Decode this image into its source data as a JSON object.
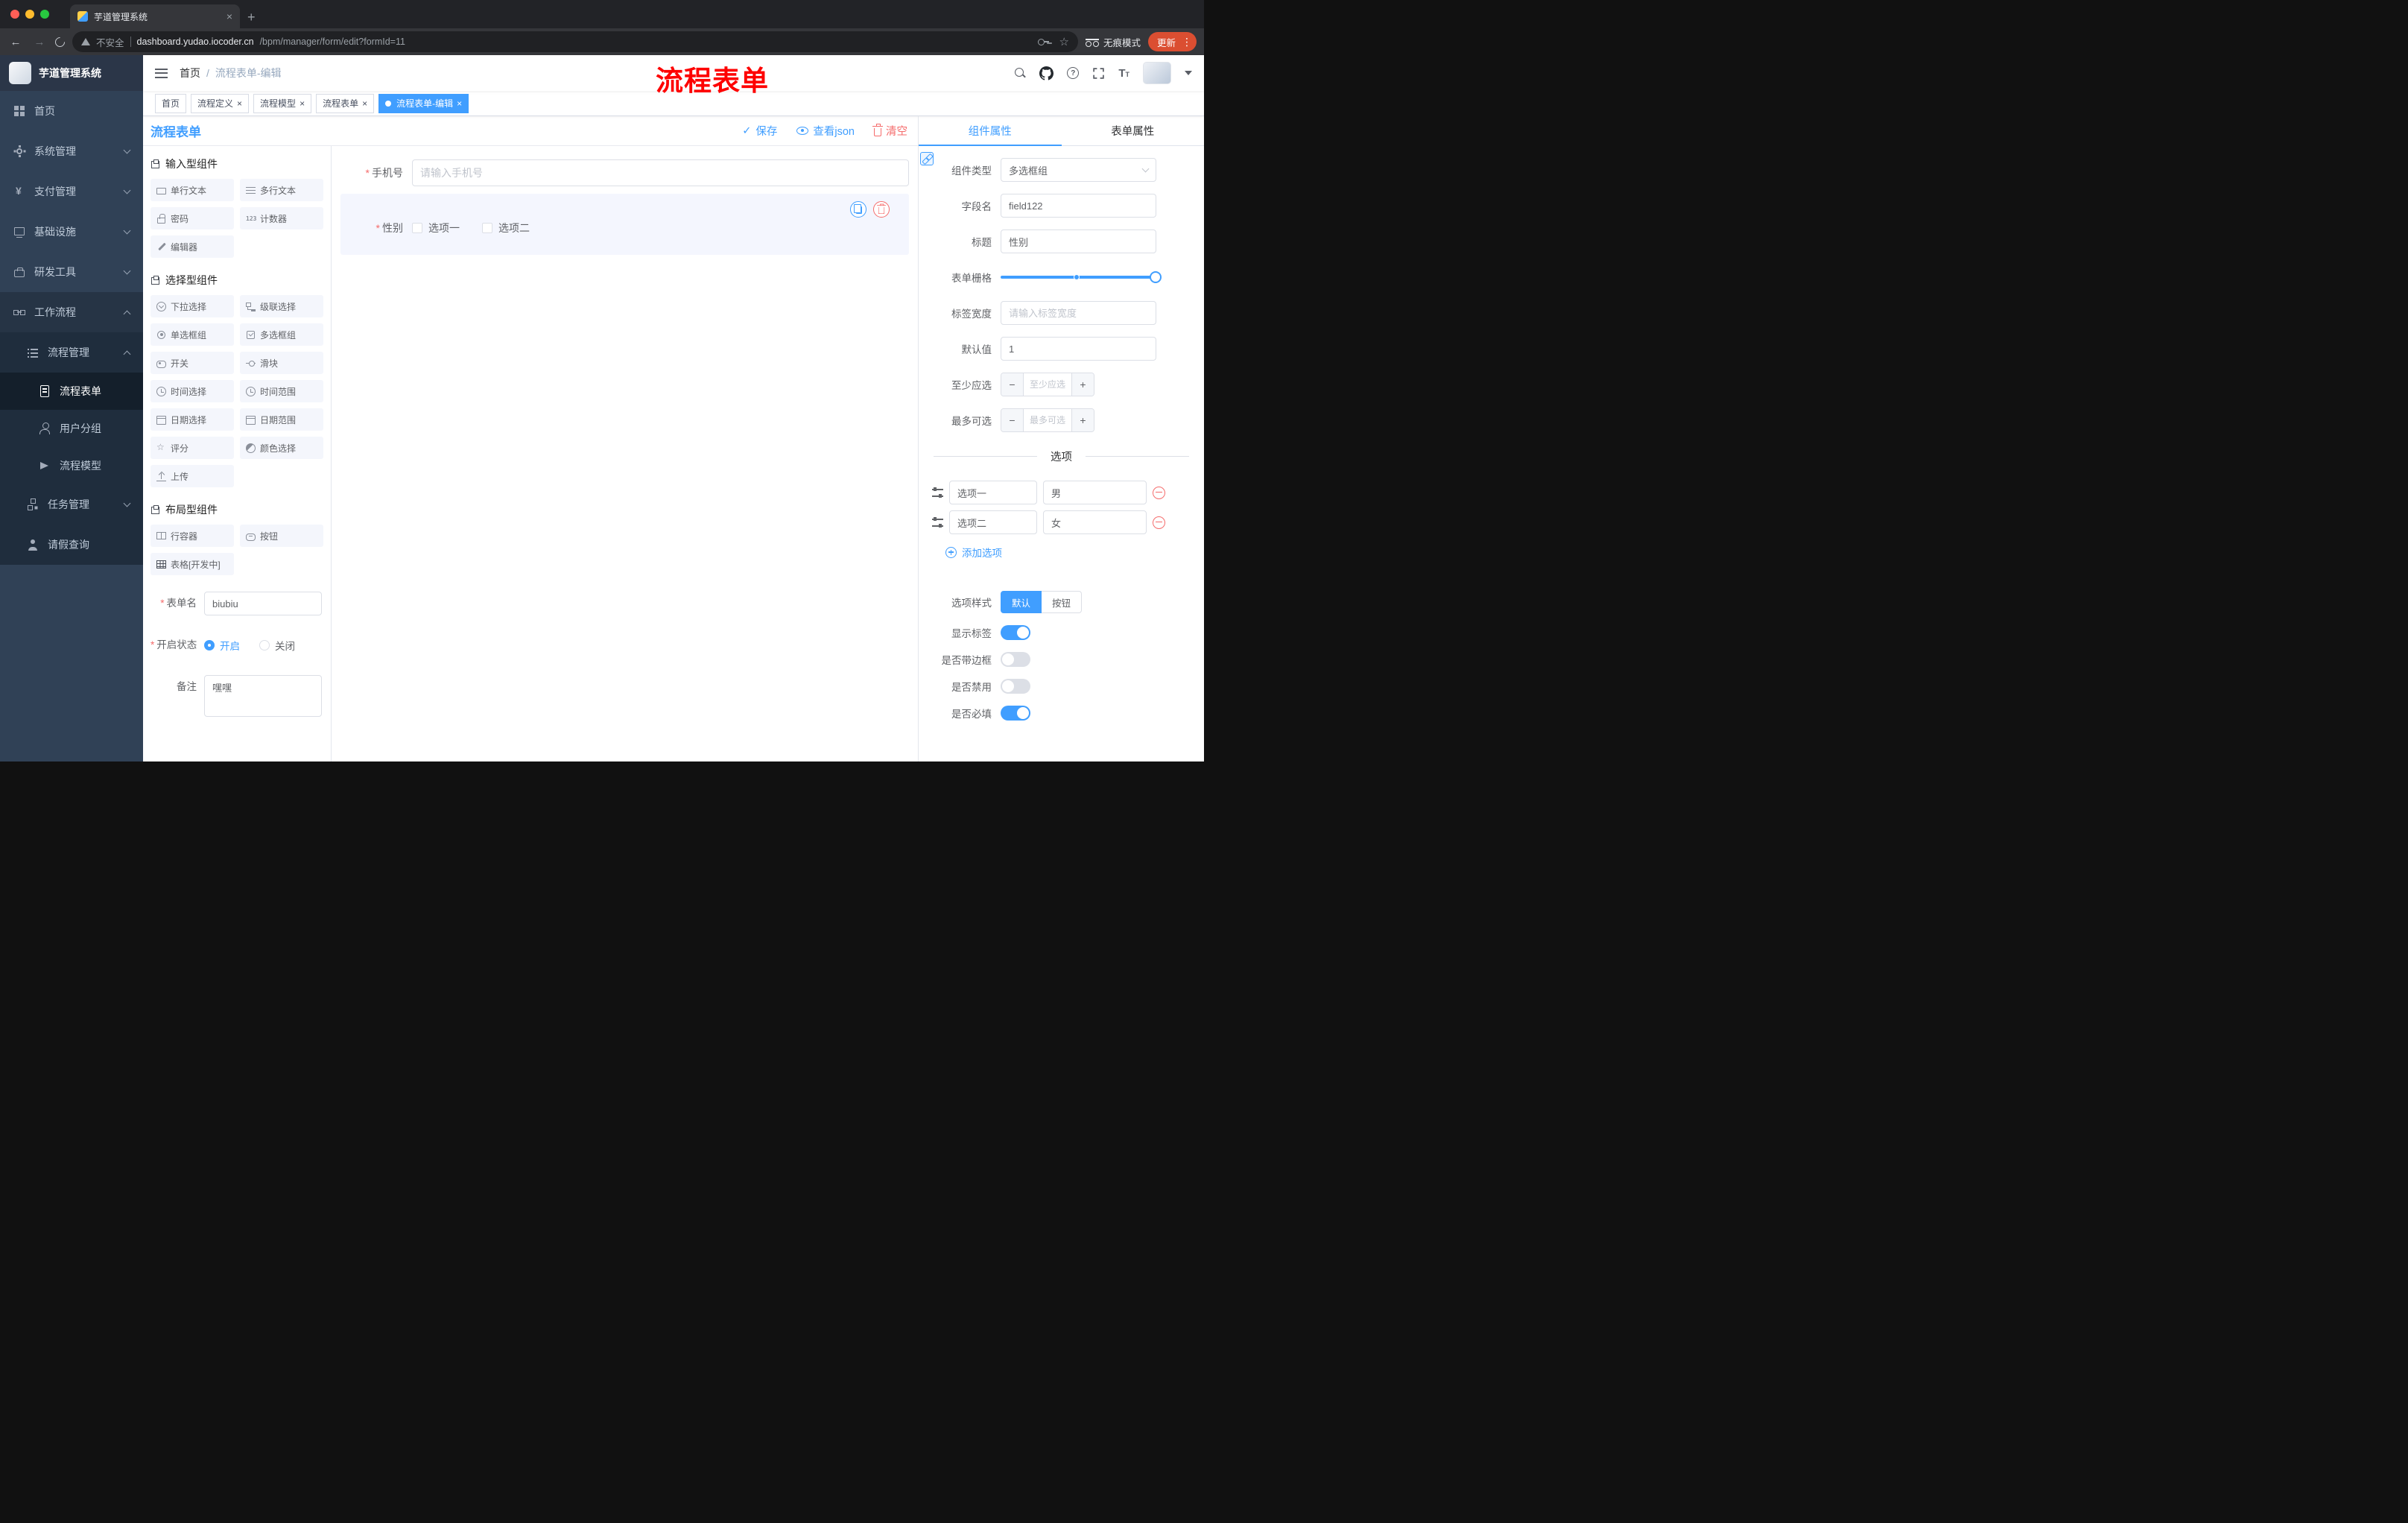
{
  "browser": {
    "tab_title": "芋道管理系统",
    "security_label": "不安全",
    "url_host": "dashboard.yudao.iocoder.cn",
    "url_path": "/bpm/manager/form/edit?formId=11",
    "incognito_label": "无痕模式",
    "update_label": "更新"
  },
  "sidebar": {
    "logo_title": "芋道管理系统",
    "menu": {
      "home": "首页",
      "system": "系统管理",
      "payment": "支付管理",
      "infra": "基础设施",
      "devtools": "研发工具",
      "workflow": "工作流程",
      "process_mgmt": "流程管理",
      "process_form": "流程表单",
      "user_group": "用户分组",
      "process_model": "流程模型",
      "task_mgmt": "任务管理",
      "leave_query": "请假查询"
    }
  },
  "header": {
    "breadcrumb_home": "首页",
    "breadcrumb_current": "流程表单-编辑",
    "annotation": "流程表单"
  },
  "tagsview": [
    "首页",
    "流程定义",
    "流程模型",
    "流程表单",
    "流程表单-编辑"
  ],
  "designer": {
    "title": "流程表单",
    "save": "保存",
    "view_json": "查看json",
    "clear": "清空"
  },
  "palette": {
    "groups": [
      {
        "title": "输入型组件",
        "items": [
          {
            "label": "单行文本",
            "icon": "text-field"
          },
          {
            "label": "多行文本",
            "icon": "textarea"
          },
          {
            "label": "密码",
            "icon": "lock"
          },
          {
            "label": "计数器",
            "icon": "counter-123"
          },
          {
            "label": "编辑器",
            "icon": "editor-pencil"
          }
        ]
      },
      {
        "title": "选择型组件",
        "items": [
          {
            "label": "下拉选择",
            "icon": "select-dropdown"
          },
          {
            "label": "级联选择",
            "icon": "cascader-tree"
          },
          {
            "label": "单选框组",
            "icon": "radio-group"
          },
          {
            "label": "多选框组",
            "icon": "checkbox-group"
          },
          {
            "label": "开关",
            "icon": "switch"
          },
          {
            "label": "滑块",
            "icon": "slider"
          },
          {
            "label": "时间选择",
            "icon": "time-clock"
          },
          {
            "label": "时间范围",
            "icon": "time-range-clock"
          },
          {
            "label": "日期选择",
            "icon": "date-calendar"
          },
          {
            "label": "日期范围",
            "icon": "date-range-calendar"
          },
          {
            "label": "评分",
            "icon": "rate-star"
          },
          {
            "label": "颜色选择",
            "icon": "color-picker"
          },
          {
            "label": "上传",
            "icon": "upload"
          }
        ]
      },
      {
        "title": "布局型组件",
        "items": [
          {
            "label": "行容器",
            "icon": "row-container"
          },
          {
            "label": "按钮",
            "icon": "button"
          },
          {
            "label": "表格[开发中]",
            "icon": "table-grid"
          }
        ]
      }
    ]
  },
  "form_meta": {
    "name_label": "表单名",
    "name_value": "biubiu",
    "status_label": "开启状态",
    "status_on": "开启",
    "status_off": "关闭",
    "remark_label": "备注",
    "remark_value": "嘿嘿"
  },
  "canvas": {
    "phone": {
      "label": "手机号",
      "placeholder": "请输入手机号"
    },
    "gender": {
      "label": "性别",
      "option1": "选项一",
      "option2": "选项二"
    }
  },
  "props": {
    "tab_component": "组件属性",
    "tab_form": "表单属性",
    "rows": {
      "component_type_label": "组件类型",
      "component_type_value": "多选框组",
      "field_name_label": "字段名",
      "field_name_value": "field122",
      "title_label": "标题",
      "title_value": "性别",
      "grid_label": "表单栅格",
      "label_width_label": "标签宽度",
      "label_width_placeholder": "请输入标签宽度",
      "default_label": "默认值",
      "default_value": "1",
      "min_label": "至少应选",
      "min_placeholder": "至少应选",
      "max_label": "最多可选",
      "max_placeholder": "最多可选"
    },
    "options_divider": "选项",
    "options": [
      {
        "name": "选项一",
        "value": "男"
      },
      {
        "name": "选项二",
        "value": "女"
      }
    ],
    "add_option": "添加选项",
    "style_label": "选项样式",
    "style_default": "默认",
    "style_button": "按钮",
    "show_label": "显示标签",
    "border_label": "是否带边框",
    "disabled_label": "是否禁用",
    "required_label": "是否必填"
  },
  "colors": {
    "accent": "#409EFF",
    "danger": "#F56C6C",
    "annotation_red": "#FE0000",
    "update_badge": "#DB4E31",
    "sidebar_bg": "#304156",
    "submenu_bg": "#1F2D3D"
  }
}
